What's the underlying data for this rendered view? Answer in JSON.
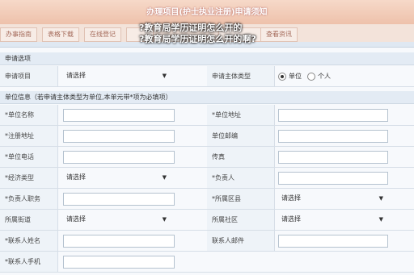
{
  "header": {
    "title": "办理项目(护士执业注册)申请须知"
  },
  "overlay_text": {
    "line1": "?教育局学历证明怎么开的",
    "line2": "?教育局学历证明怎么开的啊?"
  },
  "tabs": [
    "办事指南",
    "表格下载",
    "在线登记",
    "",
    "",
    "查看资讯"
  ],
  "sections": {
    "apply": "申请选项",
    "unit": "单位信息（若申请主体类型为单位,本单元带*项为必填项）"
  },
  "apply_row": {
    "label_left": "申请项目",
    "select_left": "请选择",
    "label_right": "申请主体类型",
    "radio1": "单位",
    "radio2": "个人"
  },
  "form_rows": [
    {
      "left": "*单位名称",
      "right": "*单位地址"
    },
    {
      "left": "*注册地址",
      "right": "单位邮编"
    },
    {
      "left": "*单位电话",
      "right": "传真"
    },
    {
      "left": "*经济类型",
      "left_select": "请选择",
      "right": "*负责人"
    },
    {
      "left": "*负责人职务",
      "right": "*所属区县",
      "right_select": "请选择"
    },
    {
      "left": "所属街道",
      "left_select": "请选择",
      "right": "所属社区",
      "right_select": "请选择"
    },
    {
      "left": "*联系人姓名",
      "right": "联系人邮件"
    },
    {
      "left": "*联系人手机"
    }
  ],
  "icons": {
    "dropdown": "triangle-down-icon",
    "radio": "radio-icon"
  },
  "colors": {
    "title_bar": "#eec1ab",
    "panel_bg": "#f7f9fc",
    "section_bg": "#e3ebf4"
  }
}
